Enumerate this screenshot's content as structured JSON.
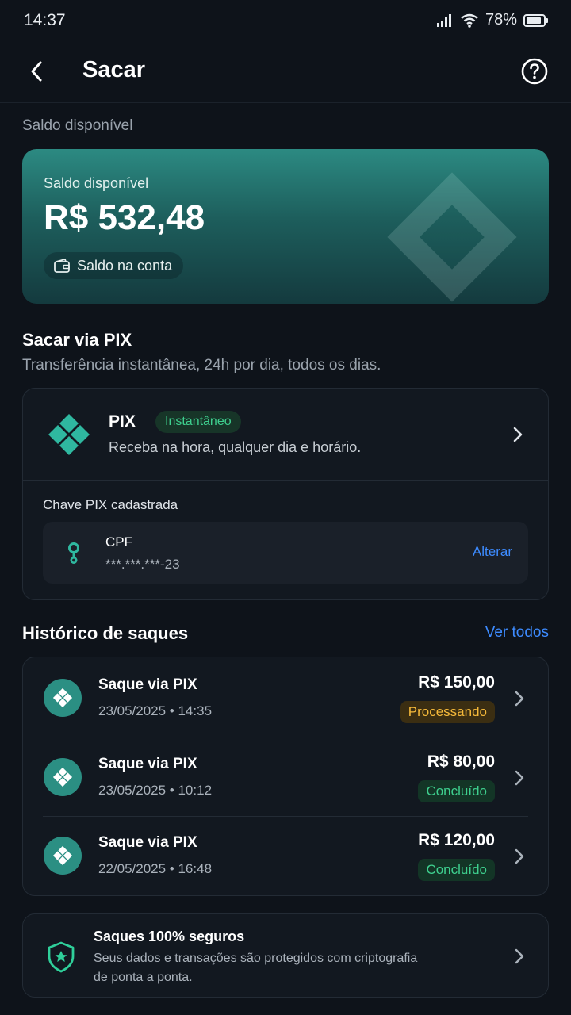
{
  "status_bar": {
    "time": "14:37",
    "battery": "78%"
  },
  "header": {
    "title": "Sacar"
  },
  "balance_section_label": "Saldo disponível",
  "balance_card": {
    "label": "Saldo disponível",
    "value": "R$ 532,48",
    "account_chip": "Saldo na conta"
  },
  "pix_section": {
    "title": "Sacar via PIX",
    "subtitle": "Transferência instantânea, 24h por dia, todos os dias."
  },
  "pix_method": {
    "name": "PIX",
    "badge": "Instantâneo",
    "description": "Receba na hora, qualquer dia e horário."
  },
  "pix_key": {
    "label": "Chave PIX cadastrada",
    "type": "CPF",
    "value": "***.***.***-23",
    "change_label": "Alterar"
  },
  "history": {
    "title": "Histórico de saques",
    "see_all": "Ver todos",
    "items": [
      {
        "title": "Saque via PIX",
        "date": "23/05/2025 • 14:35",
        "amount": "R$ 150,00",
        "status": "Processando",
        "status_kind": "processing"
      },
      {
        "title": "Saque via PIX",
        "date": "23/05/2025 • 10:12",
        "amount": "R$ 80,00",
        "status": "Concluído",
        "status_kind": "done"
      },
      {
        "title": "Saque via PIX",
        "date": "22/05/2025 • 16:48",
        "amount": "R$ 120,00",
        "status": "Concluído",
        "status_kind": "done"
      }
    ]
  },
  "security": {
    "title": "Saques 100% seguros",
    "description": "Seus dados e transações são protegidos com criptografia de ponta a ponta."
  },
  "colors": {
    "background": "#0e131a",
    "accent_teal": "#2b8f83",
    "link_blue": "#3d8bff",
    "success_green": "#3ecf8e",
    "warning_amber": "#f5b93a"
  },
  "icons": [
    "back-arrow-icon",
    "help-icon",
    "wallet-icon",
    "pix-logo-icon",
    "chevron-right-icon",
    "key-icon",
    "shield-icon",
    "signal-icon",
    "wifi-icon",
    "battery-icon"
  ]
}
